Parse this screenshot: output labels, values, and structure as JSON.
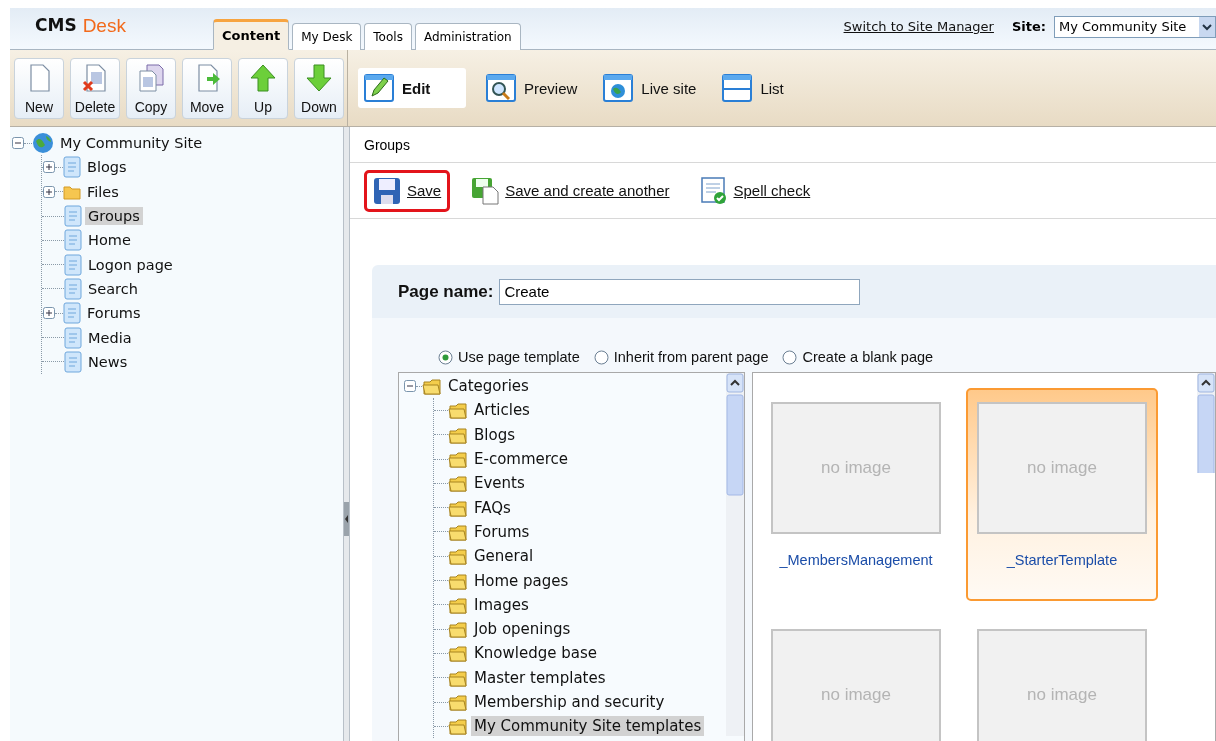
{
  "header": {
    "logo": {
      "brand": "CMS",
      "product": "Desk"
    },
    "tabs": [
      {
        "label": "Content",
        "selected": true
      },
      {
        "label": "My Desk",
        "selected": false
      },
      {
        "label": "Tools",
        "selected": false
      },
      {
        "label": "Administration",
        "selected": false
      }
    ],
    "switch_link": "Switch to Site Manager",
    "site_label": "Site:",
    "site_value": "My Community Site"
  },
  "toolbar": {
    "buttons": [
      {
        "label": "New",
        "kind": "new"
      },
      {
        "label": "Delete",
        "kind": "delete"
      },
      {
        "label": "Copy",
        "kind": "copy"
      },
      {
        "label": "Move",
        "kind": "move"
      },
      {
        "label": "Up",
        "kind": "up"
      },
      {
        "label": "Down",
        "kind": "down"
      }
    ],
    "views": [
      {
        "label": "Edit",
        "kind": "edit",
        "selected": true
      },
      {
        "label": "Preview",
        "kind": "preview",
        "selected": false
      },
      {
        "label": "Live site",
        "kind": "live",
        "selected": false
      },
      {
        "label": "List",
        "kind": "list",
        "selected": false
      }
    ]
  },
  "content_tree": {
    "label": "My Community Site",
    "kind": "site",
    "expanded": true,
    "selected": false,
    "children": [
      {
        "label": "Blogs",
        "kind": "page",
        "expanded": false,
        "selected": false
      },
      {
        "label": "Files",
        "kind": "folder",
        "expanded": false,
        "selected": false
      },
      {
        "label": "Groups",
        "kind": "page",
        "selected": true
      },
      {
        "label": "Home",
        "kind": "page",
        "selected": false
      },
      {
        "label": "Logon page",
        "kind": "page",
        "selected": false
      },
      {
        "label": "Search",
        "kind": "page",
        "selected": false
      },
      {
        "label": "Forums",
        "kind": "page",
        "expanded": false,
        "selected": false
      },
      {
        "label": "Media",
        "kind": "page",
        "selected": false
      },
      {
        "label": "News",
        "kind": "page",
        "selected": false
      }
    ]
  },
  "breadcrumb": "Groups",
  "actions": [
    {
      "label": "Save",
      "kind": "save",
      "highlighted": true
    },
    {
      "label": "Save and create another",
      "kind": "save-another",
      "highlighted": false
    },
    {
      "label": "Spell check",
      "kind": "spell",
      "highlighted": false
    }
  ],
  "form": {
    "page_name_label": "Page name:",
    "page_name_value": "Create",
    "template_options": [
      {
        "label": "Use page template",
        "selected": true
      },
      {
        "label": "Inherit from parent page",
        "selected": false
      },
      {
        "label": "Create a blank page",
        "selected": false
      }
    ],
    "categories": {
      "label": "Categories",
      "expanded": true,
      "selected": false,
      "children": [
        {
          "label": "Articles",
          "selected": false
        },
        {
          "label": "Blogs",
          "selected": false
        },
        {
          "label": "E-commerce",
          "selected": false
        },
        {
          "label": "Events",
          "selected": false
        },
        {
          "label": "FAQs",
          "selected": false
        },
        {
          "label": "Forums",
          "selected": false
        },
        {
          "label": "General",
          "selected": false
        },
        {
          "label": "Home pages",
          "selected": false
        },
        {
          "label": "Images",
          "selected": false
        },
        {
          "label": "Job openings",
          "selected": false
        },
        {
          "label": "Knowledge base",
          "selected": false
        },
        {
          "label": "Master templates",
          "selected": false
        },
        {
          "label": "Membership and security",
          "selected": false
        },
        {
          "label": "My Community Site templates",
          "selected": true
        }
      ]
    },
    "templates": [
      {
        "placeholder": "no image",
        "name": "_MembersManagement",
        "selected": false
      },
      {
        "placeholder": "no image",
        "name": "_StarterTemplate",
        "selected": true
      },
      {
        "placeholder": "no image",
        "selected": false
      },
      {
        "placeholder": "no image",
        "selected": false
      }
    ]
  }
}
